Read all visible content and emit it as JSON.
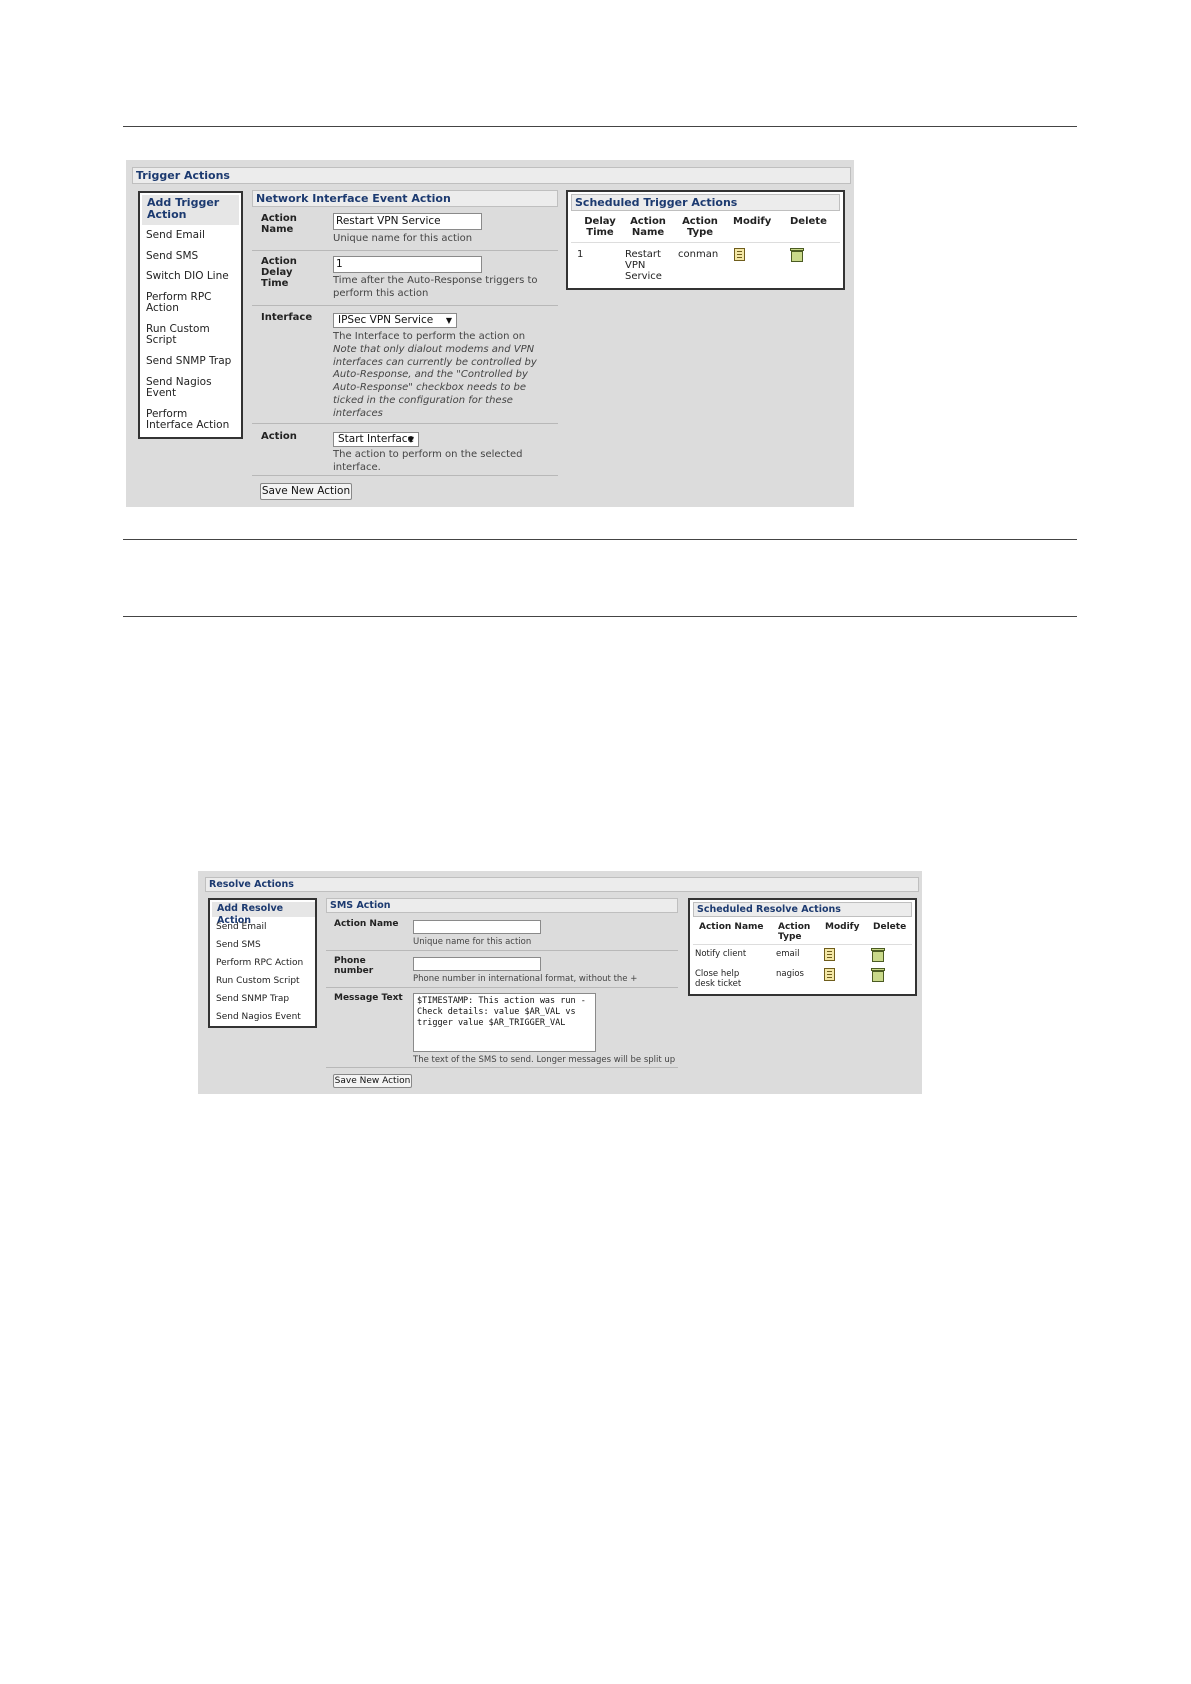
{
  "trigger": {
    "title": "Trigger Actions",
    "menu": {
      "header": "Add Trigger Action",
      "items": [
        "Send Email",
        "Send SMS",
        "Switch DIO Line",
        "Perform RPC Action",
        "Run Custom Script",
        "Send SNMP Trap",
        "Send Nagios Event",
        "Perform Interface Action"
      ]
    },
    "form": {
      "title": "Network Interface Event Action",
      "action_name_label": "Action Name",
      "action_name_value": "Restart VPN Service",
      "action_name_help": "Unique name for this action",
      "delay_label": "Action Delay Time",
      "delay_value": "1",
      "delay_help": "Time after the Auto-Response triggers to perform this action",
      "interface_label": "Interface",
      "interface_value": "IPSec VPN Service",
      "interface_help": "The Interface to perform the action on",
      "interface_note": "Note that only dialout modems and VPN interfaces can currently be controlled by Auto-Response, and the \"Controlled by Auto-Response\" checkbox needs to be ticked in the configuration for these interfaces",
      "action_label": "Action",
      "action_value": "Start Interface",
      "action_help": "The action to perform on the selected interface.",
      "save_label": "Save New Action"
    },
    "scheduled": {
      "title": "Scheduled Trigger Actions",
      "headers": [
        "Delay Time",
        "Action Name",
        "Action Type",
        "Modify",
        "Delete"
      ],
      "rows": [
        {
          "delay": "1",
          "name": "Restart VPN Service",
          "type": "conman"
        }
      ]
    }
  },
  "resolve": {
    "title": "Resolve Actions",
    "menu": {
      "header": "Add Resolve Action",
      "items": [
        "Send Email",
        "Send SMS",
        "Perform RPC Action",
        "Run Custom Script",
        "Send SNMP Trap",
        "Send Nagios Event"
      ]
    },
    "form": {
      "title": "SMS Action",
      "action_name_label": "Action Name",
      "action_name_help": "Unique name for this action",
      "phone_label": "Phone number",
      "phone_help": "Phone number in international format, without the +",
      "message_label": "Message Text",
      "message_value": "$TIMESTAMP: This action was run - Check details: value $AR_VAL vs trigger value $AR_TRIGGER_VAL",
      "message_help": "The text of the SMS to send. Longer messages will be split up",
      "save_label": "Save New Action"
    },
    "scheduled": {
      "title": "Scheduled Resolve Actions",
      "headers": [
        "Action Name",
        "Action Type",
        "Modify",
        "Delete"
      ],
      "rows": [
        {
          "name": "Notify client",
          "type": "email"
        },
        {
          "name": "Close help desk ticket",
          "type": "nagios"
        }
      ]
    }
  }
}
